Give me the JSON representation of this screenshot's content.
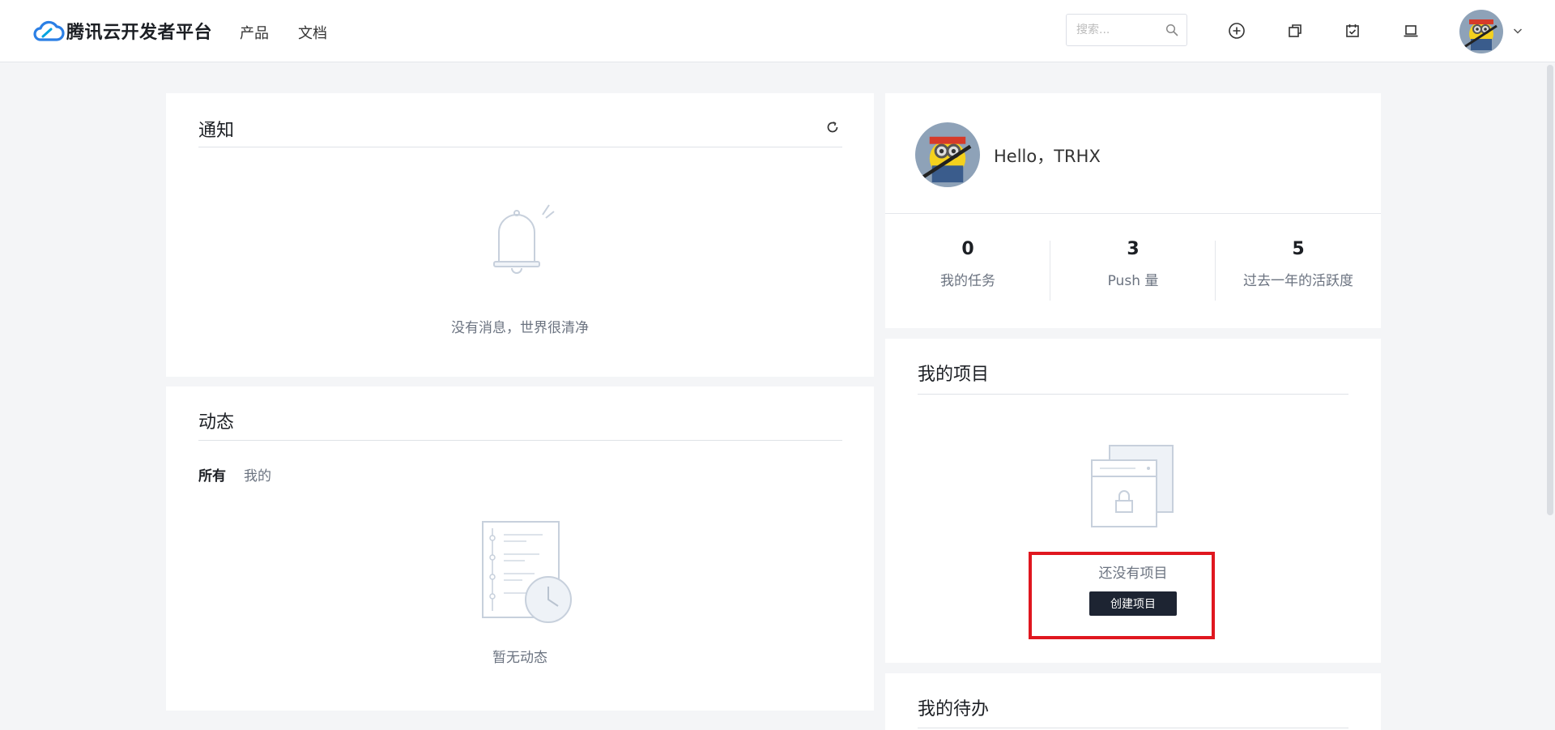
{
  "header": {
    "brand": "腾讯云开发者平台",
    "nav": [
      "产品",
      "文档"
    ],
    "search_placeholder": "搜索...",
    "icons": [
      "plus-circle-icon",
      "copy-icon",
      "calendar-check-icon",
      "laptop-icon"
    ]
  },
  "notice": {
    "title": "通知",
    "empty_text": "没有消息，世界很清净"
  },
  "activity": {
    "title": "动态",
    "tabs": [
      "所有",
      "我的"
    ],
    "empty_text": "暂无动态"
  },
  "profile": {
    "greeting": "Hello，TRHX",
    "stats": [
      {
        "value": "0",
        "label": "我的任务"
      },
      {
        "value": "3",
        "label": "Push 量"
      },
      {
        "value": "5",
        "label": "过去一年的活跃度"
      }
    ]
  },
  "projects": {
    "title": "我的项目",
    "empty_text": "还没有项目",
    "create_label": "创建项目"
  },
  "todo": {
    "title": "我的待办"
  },
  "colors": {
    "highlight": "#e0171f",
    "button_bg": "#1d2432",
    "page_bg": "#f4f5f7"
  }
}
